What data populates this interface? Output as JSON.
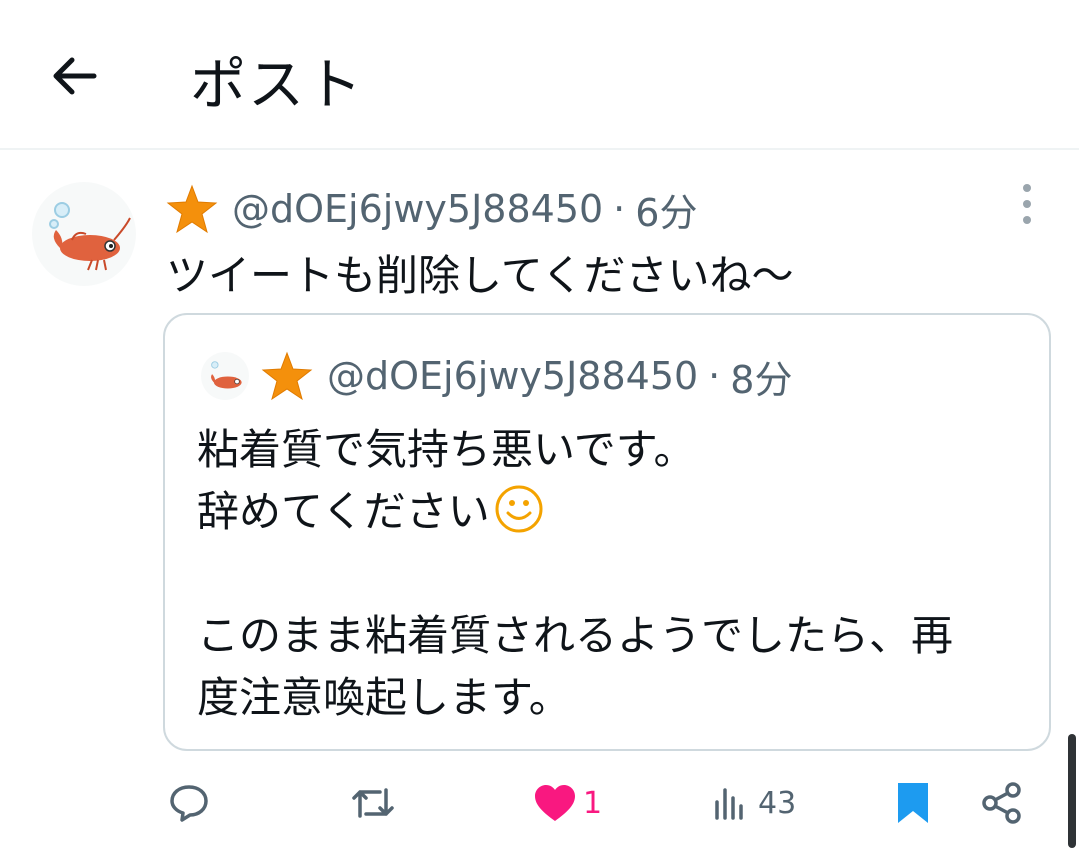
{
  "header": {
    "title": "ポスト",
    "back_icon": "arrow-left-icon"
  },
  "tweet": {
    "handle": "@dOEj6jwy5J88450",
    "separator": "·",
    "time": "6分",
    "text": "ツイートも削除してくださいね〜",
    "more_icon": "more-vertical-icon"
  },
  "quote": {
    "handle": "@dOEj6jwy5J88450",
    "separator": "·",
    "time": "8分",
    "lines": [
      "粘着質で気持ち悪いです。",
      "辞めてください",
      "",
      "このまま粘着質されるようでしたら、再",
      "度注意喚起します。"
    ],
    "emoji": "smiley-emoji"
  },
  "actions": {
    "reply_icon": "reply-icon",
    "repost_icon": "repost-icon",
    "like_icon": "heart-icon",
    "like_count": "1",
    "views_icon": "views-icon",
    "view_count": "43",
    "bookmark_icon": "bookmark-icon",
    "share_icon": "share-icon"
  },
  "colors": {
    "text": "#0f1419",
    "secondary": "#536471",
    "like": "#f91880",
    "bookmark": "#1d9bf0",
    "star": "#f4900c",
    "border": "#cfd9de"
  }
}
